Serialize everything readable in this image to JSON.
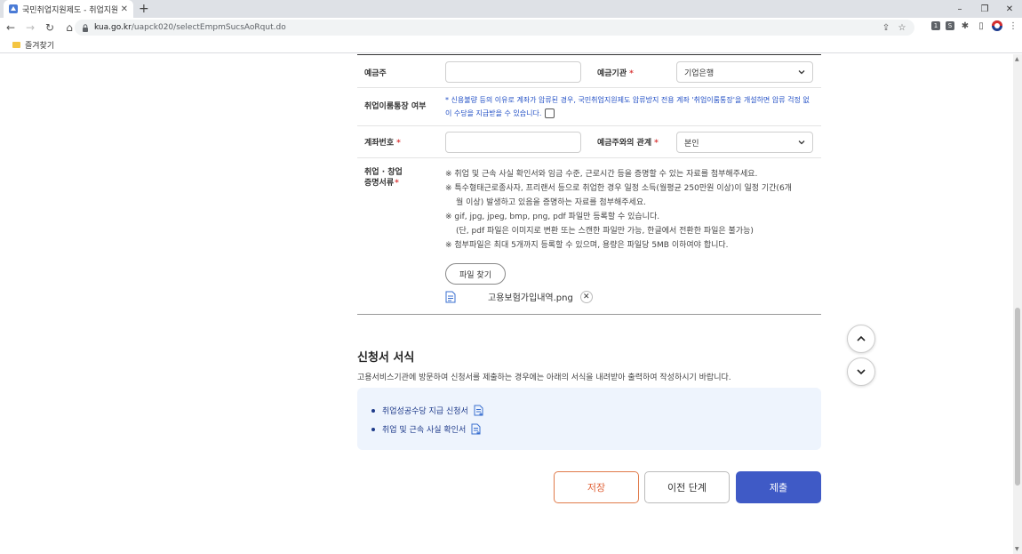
{
  "browser": {
    "tab_title": "국민취업지원제도 - 취업지원관리",
    "tab_close": "✕",
    "new_tab": "+",
    "url_host": "kua.go.kr",
    "url_path": "/uapck020/selectEmpmSucsAoRqut.do",
    "bookmark_folder": "즐겨찾기",
    "window_controls": [
      "–",
      "❐",
      "✕"
    ]
  },
  "form": {
    "depositor_label": "예금주",
    "depositor_value": "",
    "bank_label": "예금기관",
    "bank_value": "기업은행",
    "employment_account_label": "취업이룸통장 여부",
    "employment_account_notice": "* 신용불량 등의 이유로 계좌가 압류된 경우, 국민취업지원제도 압류방지 전용 계좌 '취업이룸통장'을 개설하면 압류 걱정 없이 수당을 지급받을 수 있습니다.",
    "account_number_label": "계좌번호",
    "account_number_value": "",
    "relation_label": "예금주와의 관계",
    "relation_value": "본인",
    "proof_label_line1": "취업 · 창업",
    "proof_label_line2": "증명서류",
    "notes": [
      "※ 취업 및 근속 사실 확인서와 임금 수준, 근로시간 등을 증명할 수 있는 자료를 첨부해주세요.",
      "※ 특수형태근로종사자, 프리랜서 등으로 취업한 경우 일정 소득(월평균 250만원 이상)이 일정 기간(6개",
      "월 이상) 발생하고 있음을 증명하는 자료를 첨부해주세요.",
      "※ gif, jpg, jpeg, bmp, png, pdf 파일만 등록할 수 있습니다.",
      "(단, pdf 파일은 이미지로 변환 또는 스캔한 파일만 가능, 한글에서 전환한 파일은 불가능)",
      "※ 첨부파일은 최대 5개까지 등록할 수 있으며, 용량은 파일당 5MB 이하여야 합니다."
    ],
    "file_button": "파일 찾기",
    "attached_file": "고용보험가입내역.png",
    "file_delete": "✕"
  },
  "section": {
    "title": "신청서 서식",
    "description": "고용서비스기관에 방문하여 신청서를 제출하는 경우에는 아래의 서식을 내려받아 출력하여 작성하시기 바랍니다.",
    "links": [
      "취업성공수당 지급 신청서",
      "취업 및 근속 사실 확인서"
    ]
  },
  "actions": {
    "save": "저장",
    "previous": "이전 단계",
    "submit": "제출"
  },
  "colors": {
    "accent": "#3f5ac6",
    "required": "#d93a3a",
    "notice": "#2350c6",
    "save_border": "#e07b4a"
  }
}
